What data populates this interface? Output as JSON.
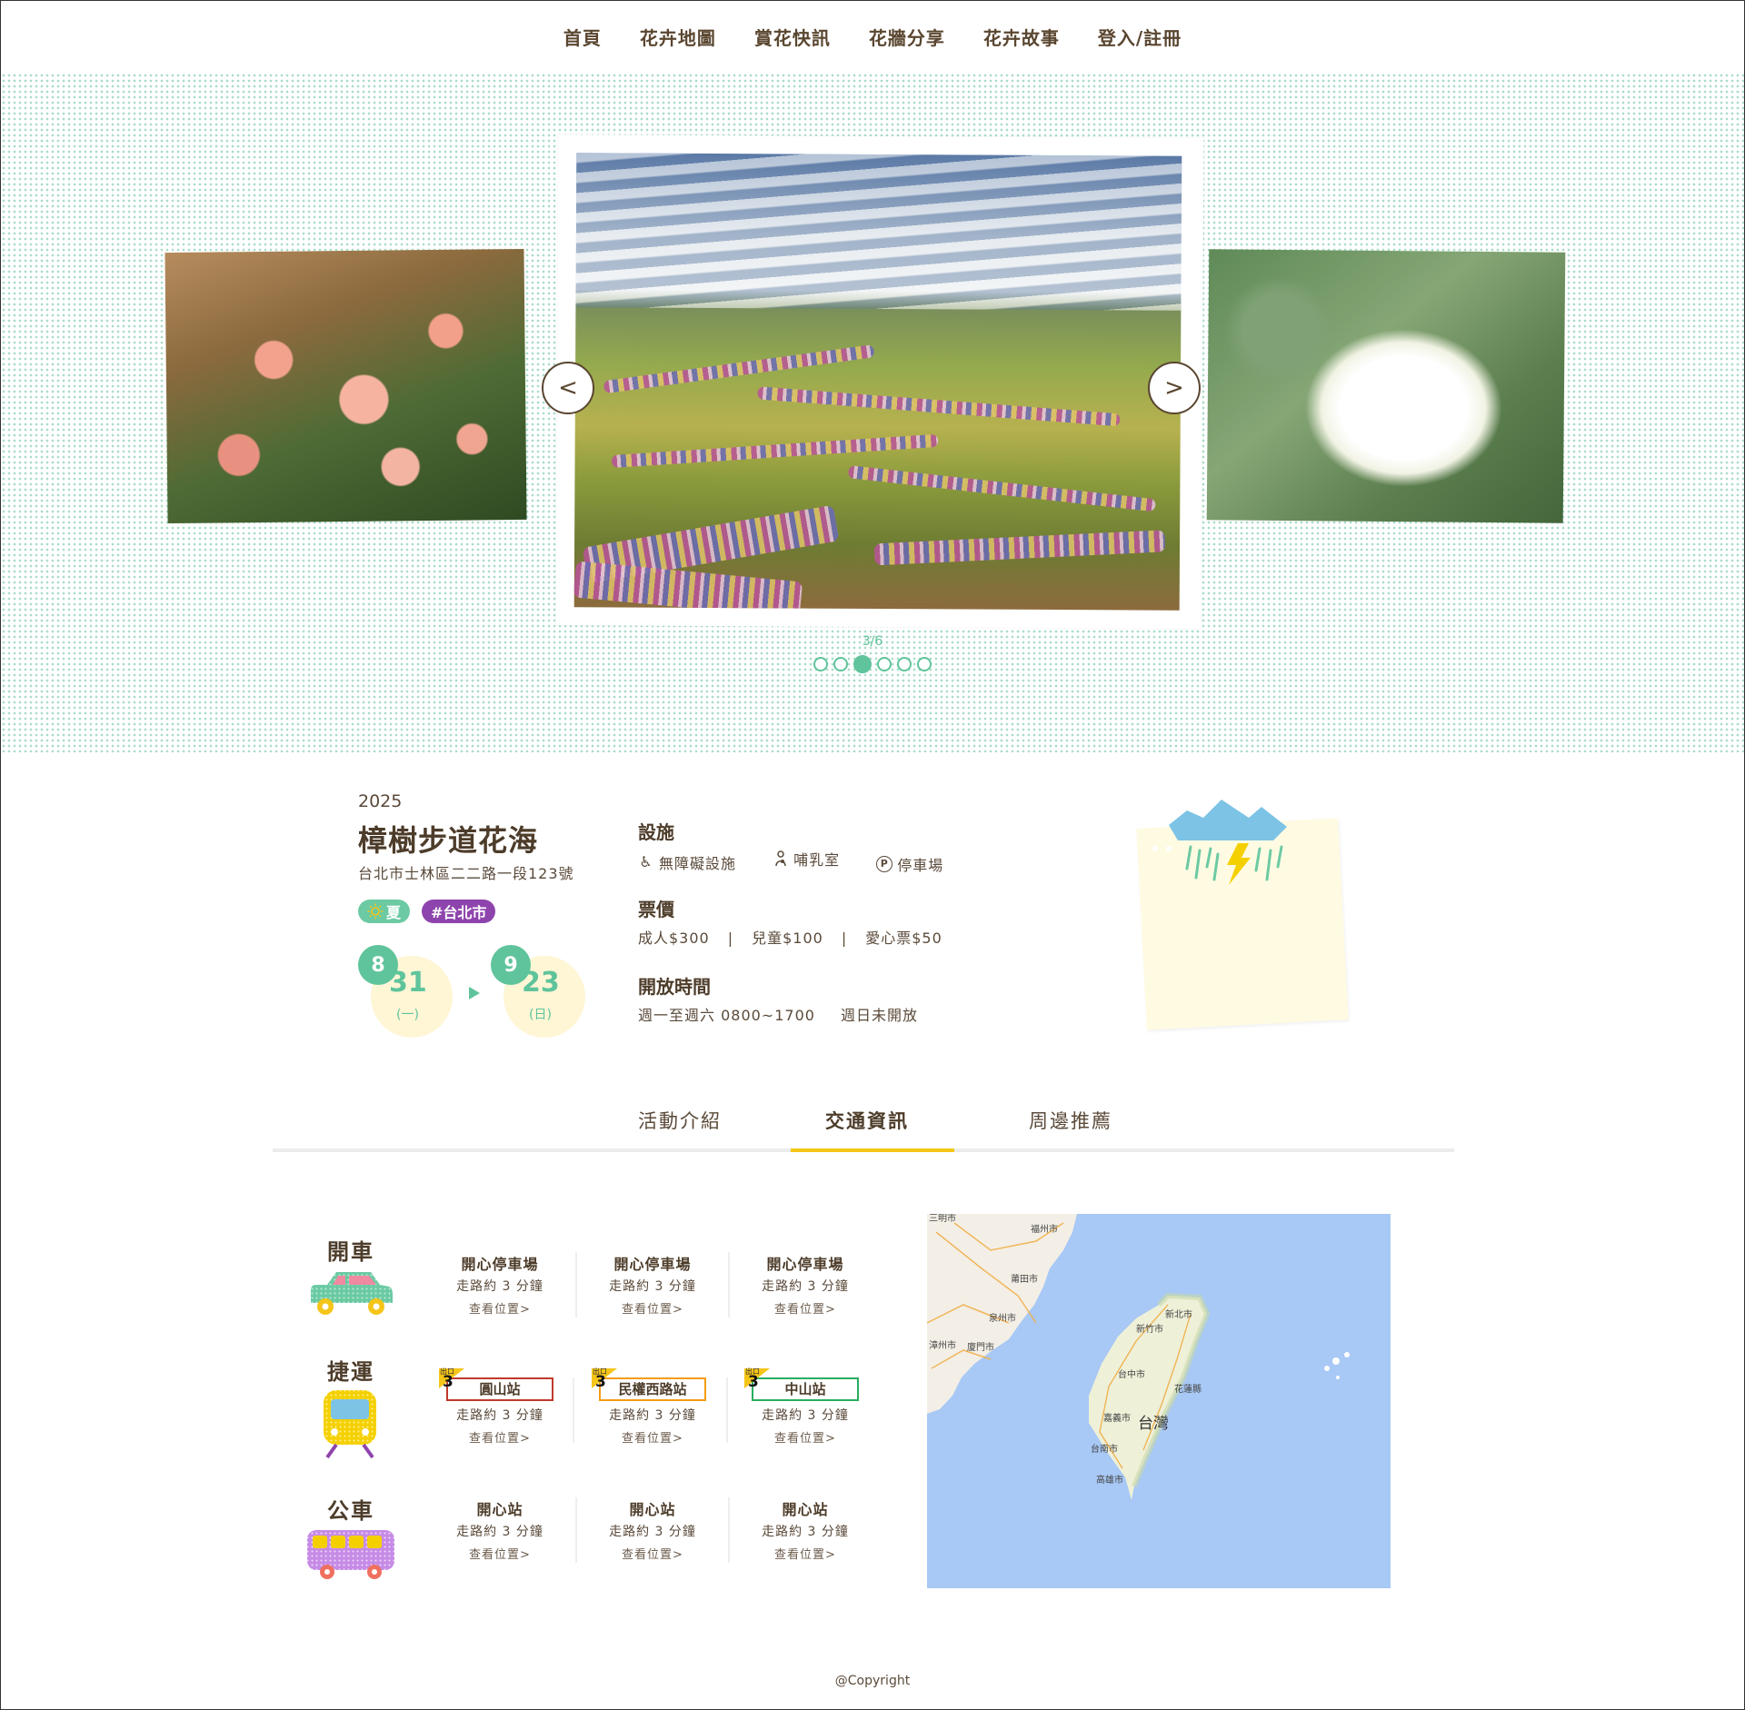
{
  "nav": {
    "items": [
      "首頁",
      "花卉地圖",
      "賞花快訊",
      "花牆分享",
      "花卉故事",
      "登入/註冊"
    ]
  },
  "carousel": {
    "prev_label": "<",
    "next_label": ">",
    "pager": "3/6",
    "current": 3,
    "total": 6
  },
  "event": {
    "year": "2025",
    "title": "樟樹步道花海",
    "address": "台北市士林區二二路一段123號",
    "tags": {
      "season": "夏",
      "city": "#台北市"
    },
    "start": {
      "month": "8",
      "day": "31",
      "weekday": "(一)"
    },
    "end": {
      "month": "9",
      "day": "23",
      "weekday": "(日)"
    }
  },
  "facilities": {
    "heading": "設施",
    "items": [
      {
        "icon": "wheelchair-icon",
        "label": "無障礙設施"
      },
      {
        "icon": "nursing-room-icon",
        "label": "哺乳室"
      },
      {
        "icon": "parking-icon",
        "label": "停車場"
      }
    ]
  },
  "tickets": {
    "heading": "票價",
    "adult": "成人$300",
    "child": "兒童$100",
    "concession": "愛心票$50",
    "separator": "|"
  },
  "hours": {
    "heading": "開放時間",
    "weekday": "週一至週六 0800~1700",
    "weekend": "週日未開放"
  },
  "weather": {
    "icon": "thunderstorm-icon"
  },
  "tabs": {
    "items": [
      "活動介紹",
      "交通資訊",
      "周邊推薦"
    ],
    "active": 1
  },
  "transport": {
    "walk": "走路約 3 分鐘",
    "view": "查看位置>",
    "exit_label": "出口",
    "car": {
      "label": "開車",
      "icon": "car-icon",
      "items": [
        "開心停車場",
        "開心停車場",
        "開心停車場"
      ]
    },
    "mrt": {
      "label": "捷運",
      "icon": "train-icon",
      "items": [
        {
          "name": "圓山站",
          "exit": "3",
          "color": "#c0392b"
        },
        {
          "name": "民權西路站",
          "exit": "3",
          "color": "#f39c12"
        },
        {
          "name": "中山站",
          "exit": "3",
          "color": "#27ae60"
        }
      ]
    },
    "bus": {
      "label": "公車",
      "icon": "bus-icon",
      "items": [
        "開心站",
        "開心站",
        "開心站"
      ]
    }
  },
  "map": {
    "labels": {
      "fuzhou": "福州市",
      "putian": "莆田市",
      "quanzhou": "泉州市",
      "zhangzhou": "漳州市",
      "xiamen": "廈門市",
      "sanming": "三明市",
      "xinbei": "新北市",
      "xinzhu": "新竹市",
      "taizhong": "台中市",
      "hualian": "花蓮縣",
      "jiayi": "嘉義市",
      "tainan": "台南市",
      "gaoxiong": "高雄市",
      "taiwan": "台灣"
    }
  },
  "footer": {
    "copyright": "@Copyright"
  },
  "colors": {
    "accent_green": "#5fc49b",
    "accent_yellow": "#f5c518",
    "tag_purple": "#8e44ad",
    "text_brown": "#5a4630"
  }
}
